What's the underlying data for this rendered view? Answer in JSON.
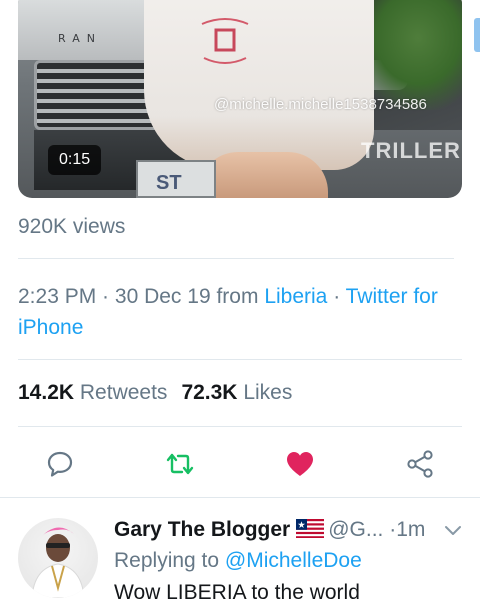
{
  "video": {
    "duration": "0:15",
    "watermark": "@michelle.michelle1538734586",
    "brand": "TRILLER",
    "car_badge": "RAN",
    "plate_text": "ST"
  },
  "views": "920K views",
  "meta": {
    "time": "2:23 PM",
    "date": "30 Dec 19",
    "from_word": "from",
    "location": "Liberia",
    "source": "Twitter for iPhone"
  },
  "stats": {
    "retweets_count": "14.2K",
    "retweets_label": "Retweets",
    "likes_count": "72.3K",
    "likes_label": "Likes"
  },
  "actions": {
    "reply_icon": "speech-bubble-icon",
    "retweet_icon": "retweet-arrows-icon",
    "like_icon": "heart-icon",
    "share_icon": "share-icon"
  },
  "colors": {
    "link": "#1da1f2",
    "retweet": "#17bf63",
    "like": "#e0245e",
    "secondary": "#657786"
  },
  "reply": {
    "name": "Gary The Blogger",
    "handle": "@G...",
    "separator": "·",
    "time": "1m",
    "replying_to_label": "Replying to",
    "replying_to_handle": "@MichelleDoe",
    "text": "Wow LIBERIA to the world"
  }
}
